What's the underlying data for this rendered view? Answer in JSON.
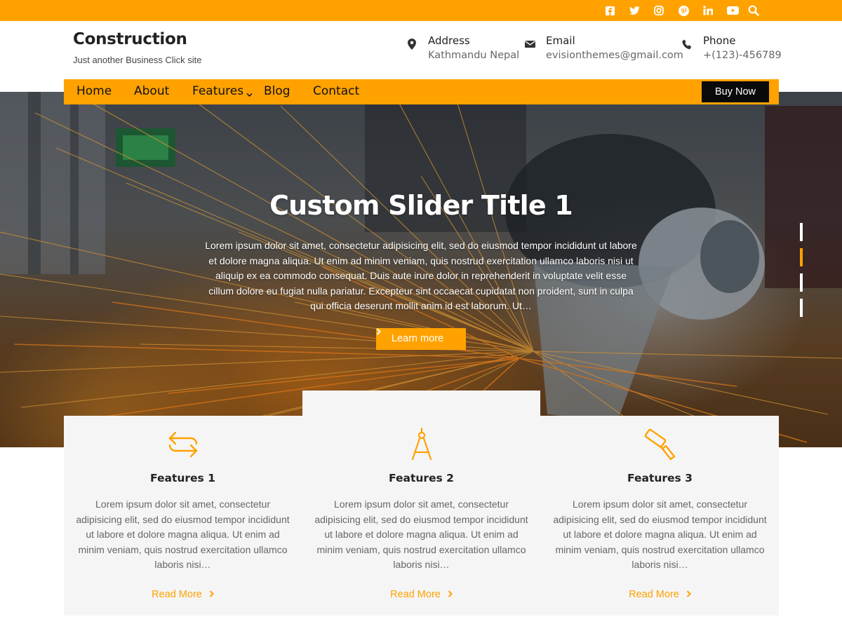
{
  "colors": {
    "accent": "#ffa200",
    "dark": "#0a0a0a",
    "feature_bg": "#f5f5f5"
  },
  "topbar": {
    "social_icons": [
      "facebook-icon",
      "twitter-icon",
      "instagram-icon",
      "pinterest-icon",
      "linkedin-icon",
      "youtube-icon"
    ],
    "search_icon": "search-icon"
  },
  "header": {
    "site_title": "Construction",
    "tagline": "Just another Business Click site",
    "address": {
      "label": "Address",
      "value": "Kathmandu Nepal",
      "icon": "map-marker-icon"
    },
    "email": {
      "label": "Email",
      "value": "evisionthemes@gmail.com",
      "icon": "envelope-icon"
    },
    "phone": {
      "label": "Phone",
      "value": "+(123)-456789",
      "icon": "phone-icon"
    }
  },
  "nav": {
    "items": [
      {
        "label": "Home"
      },
      {
        "label": "About"
      },
      {
        "label": "Features"
      },
      {
        "label": "Blog"
      },
      {
        "label": "Contact"
      }
    ],
    "cta": "Buy Now"
  },
  "hero": {
    "title": "Custom Slider Title 1",
    "text": "Lorem ipsum dolor sit amet, consectetur adipisicing elit, sed do eiusmod tempor incididunt ut labore et dolore magna aliqua. Ut enim ad minim veniam, quis nostrud exercitation ullamco laboris nisi ut aliquip ex ea commodo consequat. Duis aute irure dolor in reprehenderit in voluptate velit esse cillum dolore eu fugiat nulla pariatur. Excepteur sint occaecat cupidatat non proident, sunt in culpa qui officia deserunt mollit anim id est laborum. Ut…",
    "button": "Learn more",
    "slide_count": 4,
    "active_slide": 2
  },
  "features": [
    {
      "title": "Features 1",
      "icon": "exchange-arrows-icon",
      "text": "Lorem ipsum dolor sit amet, consectetur adipisicing elit, sed do eiusmod tempor incididunt ut labore et dolore magna aliqua. Ut enim ad minim veniam, quis nostrud exercitation ullamco laboris nisi…",
      "link": "Read More"
    },
    {
      "title": "Features 2",
      "icon": "compass-drafting-icon",
      "text": "Lorem ipsum dolor sit amet, consectetur adipisicing elit, sed do eiusmod tempor incididunt ut labore et dolore magna aliqua. Ut enim ad minim veniam, quis nostrud exercitation ullamco laboris nisi…",
      "link": "Read More"
    },
    {
      "title": "Features 3",
      "icon": "paint-roller-icon",
      "text": "Lorem ipsum dolor sit amet, consectetur adipisicing elit, sed do eiusmod tempor incididunt ut labore et dolore magna aliqua. Ut enim ad minim veniam, quis nostrud exercitation ullamco laboris nisi…",
      "link": "Read More"
    }
  ]
}
